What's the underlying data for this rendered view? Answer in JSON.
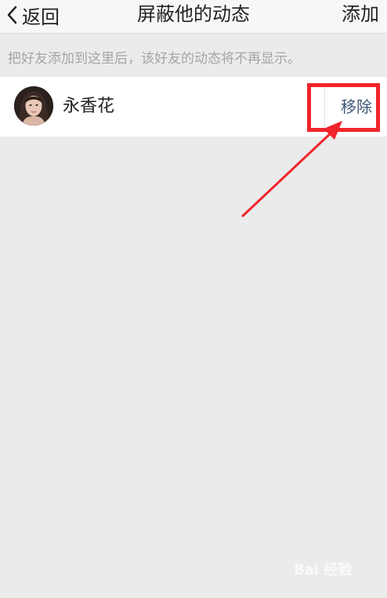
{
  "nav": {
    "back_label": "返回",
    "title": "屏蔽他的动态",
    "add_label": "添加",
    "back_icon": "chevron-left-icon"
  },
  "hint": "把好友添加到这里后，该好友的动态将不再显示。",
  "list": [
    {
      "name": "永香花",
      "action_label": "移除"
    }
  ],
  "colors": {
    "background": "#ebebeb",
    "header": "#f7f7f7",
    "action_text": "#3e5878",
    "annotation": "#f0252a"
  },
  "watermark": "Bai 经验"
}
